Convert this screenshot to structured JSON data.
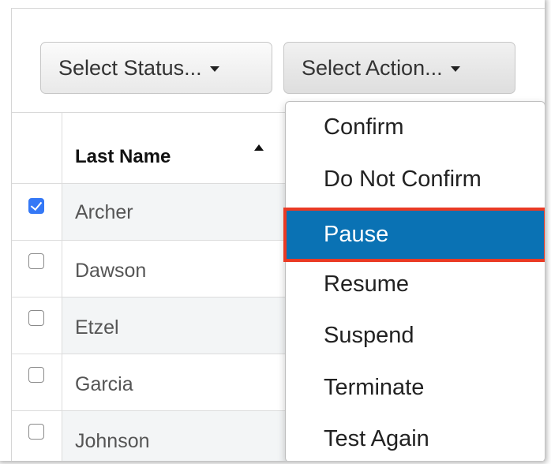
{
  "toolbar": {
    "status_button_label": "Select Status...",
    "action_button_label": "Select Action..."
  },
  "table": {
    "header": {
      "last_name": "Last Name",
      "sort": "ascending"
    },
    "rows": [
      {
        "last_name": "Archer",
        "checked": true
      },
      {
        "last_name": "Dawson",
        "checked": false
      },
      {
        "last_name": "Etzel",
        "checked": false
      },
      {
        "last_name": "Garcia",
        "checked": false
      },
      {
        "last_name": "Johnson",
        "checked": false
      }
    ]
  },
  "action_menu": {
    "items": [
      {
        "label": "Confirm"
      },
      {
        "label": "Do Not Confirm"
      },
      {
        "label": "Pause",
        "highlighted": true
      },
      {
        "label": "Resume"
      },
      {
        "label": "Suspend"
      },
      {
        "label": "Terminate"
      },
      {
        "label": "Test Again"
      }
    ]
  },
  "colors": {
    "highlight_bg": "#0a72b4",
    "highlight_outline": "#ea3a24",
    "checkbox_checked": "#3478f6"
  }
}
